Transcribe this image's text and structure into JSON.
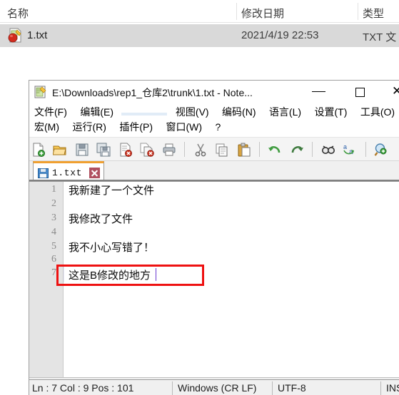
{
  "explorer": {
    "columns": [
      {
        "label": "名称"
      },
      {
        "label": "修改日期"
      },
      {
        "label": "类型"
      }
    ],
    "sort_marker": "^",
    "rows": [
      {
        "icon": "notepadpp-file-icon",
        "name": "1.txt",
        "modified": "2021/4/19 22:53",
        "type": "TXT 文"
      }
    ]
  },
  "notepadpp": {
    "window": {
      "icon": "notepadpp-icon",
      "title": "E:\\Downloads\\rep1_仓库2\\trunk\\1.txt - Note...",
      "minimize_label": "—",
      "maximize_label": "□",
      "close_label": "✕"
    },
    "menu": {
      "row1": [
        {
          "label": "文件(F)",
          "selected": false
        },
        {
          "label": "编辑(E)",
          "selected": false
        },
        {
          "label": "",
          "selected": true
        },
        {
          "label": "视图(V)",
          "selected": false
        },
        {
          "label": "编码(N)",
          "selected": false
        },
        {
          "label": "语言(L)",
          "selected": false
        },
        {
          "label": "设置(T)",
          "selected": false
        },
        {
          "label": "工具(O)",
          "selected": false
        }
      ],
      "row2": [
        {
          "label": "宏(M)",
          "selected": false
        },
        {
          "label": "运行(R)",
          "selected": false
        },
        {
          "label": "插件(P)",
          "selected": false
        },
        {
          "label": "窗口(W)",
          "selected": false
        },
        {
          "label": "?",
          "selected": false
        }
      ]
    },
    "toolbar": [
      {
        "icon": "new-file-icon"
      },
      {
        "icon": "open-file-icon"
      },
      {
        "icon": "save-icon"
      },
      {
        "icon": "save-all-icon"
      },
      {
        "icon": "close-file-icon"
      },
      {
        "icon": "close-all-files-icon"
      },
      {
        "icon": "print-icon"
      },
      {
        "icon": "separator"
      },
      {
        "icon": "cut-icon"
      },
      {
        "icon": "copy-icon"
      },
      {
        "icon": "paste-icon"
      },
      {
        "icon": "separator"
      },
      {
        "icon": "undo-icon"
      },
      {
        "icon": "redo-icon"
      },
      {
        "icon": "separator"
      },
      {
        "icon": "find-icon"
      },
      {
        "icon": "replace-icon"
      },
      {
        "icon": "separator"
      },
      {
        "icon": "zoom-in-icon"
      },
      {
        "icon": "zoom-out-icon"
      },
      {
        "icon": "separator"
      },
      {
        "icon": "sync-vertical-scroll-icon"
      },
      {
        "icon": "sync-horizontal-scroll-icon"
      }
    ],
    "tabs": [
      {
        "label": "1.txt",
        "icon": "saved-floppy-icon",
        "close_icon": "close-tab-icon",
        "active": true
      }
    ],
    "editor": {
      "line_numbers": [
        "1",
        "2",
        "3",
        "4",
        "5",
        "6",
        "7"
      ],
      "lines": [
        "我新建了一个文件",
        "",
        "我修改了文件",
        "",
        "我不小心写错了！",
        "",
        "这是B修改的地方"
      ],
      "current_line": 7,
      "annotation_color": "#ee1111",
      "current_line_color": "#e6e6f7",
      "caret_color": "#6a3ad0"
    },
    "status": {
      "position": "Ln : 7    Col : 9    Pos : 101",
      "eol": "Windows (CR LF)",
      "encoding": "UTF-8",
      "insert_mode": "INS"
    }
  }
}
